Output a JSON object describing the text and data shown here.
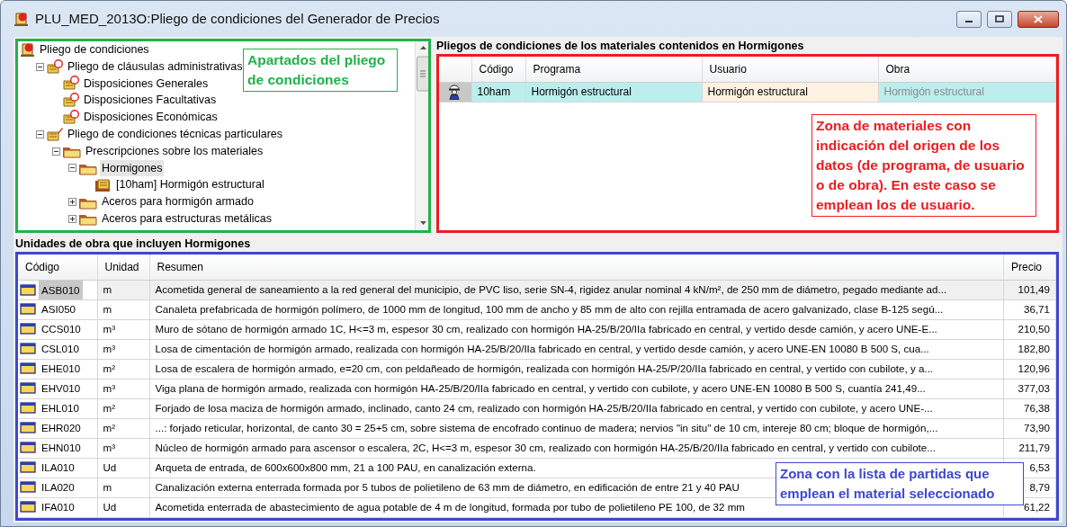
{
  "window": {
    "title": "PLU_MED_2013O:Pliego de condiciones del Generador de Precios"
  },
  "tree": {
    "items": [
      {
        "label": "Pliego de condiciones",
        "kind": "root",
        "selected": false,
        "children": [
          {
            "label": "Pliego de cláusulas administrativas",
            "kind": "admin",
            "expanded": true,
            "selected": false,
            "children": [
              {
                "label": "Disposiciones Generales",
                "kind": "admin",
                "selected": false
              },
              {
                "label": "Disposiciones Facultativas",
                "kind": "admin",
                "selected": false
              },
              {
                "label": "Disposiciones Económicas",
                "kind": "admin",
                "selected": false
              }
            ]
          },
          {
            "label": "Pliego de condiciones técnicas particulares",
            "kind": "technical",
            "expanded": true,
            "selected": false,
            "children": [
              {
                "label": "Prescripciones sobre los materiales",
                "kind": "folder",
                "expanded": true,
                "selected": false,
                "children": [
                  {
                    "label": "Hormigones",
                    "kind": "folder",
                    "expanded": true,
                    "selected": true,
                    "children": [
                      {
                        "label": "[10ham] Hormigón estructural",
                        "kind": "material",
                        "selected": false
                      }
                    ]
                  },
                  {
                    "label": "Aceros para hormigón armado",
                    "kind": "folder",
                    "expanded": false,
                    "selected": false
                  },
                  {
                    "label": "Aceros para estructuras metálicas",
                    "kind": "folder",
                    "expanded": false,
                    "selected": false
                  }
                ]
              }
            ]
          }
        ]
      }
    ]
  },
  "materials": {
    "title": "Pliegos de condiciones de los materiales contenidos en Hormigones",
    "columns": [
      "Código",
      "Programa",
      "Usuario",
      "Obra"
    ],
    "rows": [
      {
        "cells": [
          {
            "text": "10ham",
            "selected": false,
            "disabled": false
          },
          {
            "text": "Hormigón estructural",
            "selected": false,
            "disabled": false
          },
          {
            "text": "Hormigón estructural",
            "selected": true,
            "disabled": false
          },
          {
            "text": "Hormigón estructural",
            "selected": false,
            "disabled": true
          }
        ]
      }
    ]
  },
  "units": {
    "title": "Unidades de obra que incluyen Hormigones",
    "columns": [
      "Código",
      "Unidad",
      "Resumen",
      "Precio"
    ],
    "rows": [
      {
        "code": "ASB010",
        "unit": "m",
        "summary": "Acometida general de saneamiento a la red general del municipio, de PVC liso, serie SN-4, rigidez anular nominal 4 kN/m², de 250 mm de diámetro, pegado mediante ad...",
        "price": "101,49",
        "selected": true
      },
      {
        "code": "ASI050",
        "unit": "m",
        "summary": "Canaleta prefabricada de hormigón polímero, de 1000 mm de longitud, 100 mm de ancho y 85 mm de alto con rejilla entramada de acero galvanizado, clase B-125 segú...",
        "price": "36,71",
        "selected": false
      },
      {
        "code": "CCS010",
        "unit": "m³",
        "summary": "Muro de sótano de hormigón armado 1C, H<=3 m, espesor 30 cm, realizado con hormigón HA-25/B/20/IIa fabricado en central, y vertido desde camión, y acero UNE-E...",
        "price": "210,50",
        "selected": false
      },
      {
        "code": "CSL010",
        "unit": "m³",
        "summary": "Losa de cimentación de hormigón armado, realizada con hormigón HA-25/B/20/IIa fabricado en central, y vertido desde camión, y acero UNE-EN 10080 B 500 S, cua...",
        "price": "182,80",
        "selected": false
      },
      {
        "code": "EHE010",
        "unit": "m²",
        "summary": "Losa de escalera de hormigón armado, e=20 cm, con peldañeado de hormigón, realizada con hormigón HA-25/P/20/IIa fabricado en central, y vertido con cubilote, y a...",
        "price": "120,96",
        "selected": false
      },
      {
        "code": "EHV010",
        "unit": "m³",
        "summary": "Viga plana de hormigón armado, realizada con hormigón HA-25/B/20/IIa fabricado en central, y vertido con cubilote, y acero UNE-EN 10080 B 500 S, cuantía 241,49...",
        "price": "377,03",
        "selected": false
      },
      {
        "code": "EHL010",
        "unit": "m²",
        "summary": "Forjado de losa maciza de hormigón armado, inclinado, canto 24 cm, realizado con hormigón HA-25/B/20/IIa fabricado en central, y vertido con cubilote, y acero UNE-...",
        "price": "76,38",
        "selected": false
      },
      {
        "code": "EHR020",
        "unit": "m²",
        "summary": "...: forjado reticular, horizontal, de canto 30 = 25+5 cm, sobre sistema de encofrado continuo de madera; nervios \"in situ\" de 10 cm, intereje 80 cm; bloque de hormigón,...",
        "price": "73,90",
        "selected": false
      },
      {
        "code": "EHN010",
        "unit": "m³",
        "summary": "Núcleo de hormigón armado para ascensor o escalera, 2C, H<=3 m, espesor 30 cm, realizado con hormigón HA-25/B/20/IIa fabricado en central, y vertido con cubilote...",
        "price": "211,79",
        "selected": false
      },
      {
        "code": "ILA010",
        "unit": "Ud",
        "summary": "Arqueta de entrada, de 600x600x800 mm, 21 a 100 PAU, en canalización externa.",
        "price": "6,53",
        "selected": false
      },
      {
        "code": "ILA020",
        "unit": "m",
        "summary": "Canalización externa enterrada formada por 5 tubos de polietileno de 63 mm de diámetro, en edificación de entre 21 y 40 PAU",
        "price": "8,79",
        "selected": false
      },
      {
        "code": "IFA010",
        "unit": "Ud",
        "summary": "Acometida enterrada de abastecimiento de agua potable de 4 m de longitud, formada por tubo de polietileno PE 100, de 32 mm",
        "price": "61,22",
        "selected": false
      }
    ]
  },
  "annotations": [
    {
      "text": "Apartados del pliego de condiciones",
      "color": "#22b14c"
    },
    {
      "text": "Zona de materiales con indicación del origen de los datos (de programa, de usuario o de obra). En este caso se emplean  los de usuario.",
      "color": "#ed1c24"
    },
    {
      "text": "Zona con la lista de partidas que emplean el material seleccionado",
      "color": "#3f48cc"
    }
  ]
}
